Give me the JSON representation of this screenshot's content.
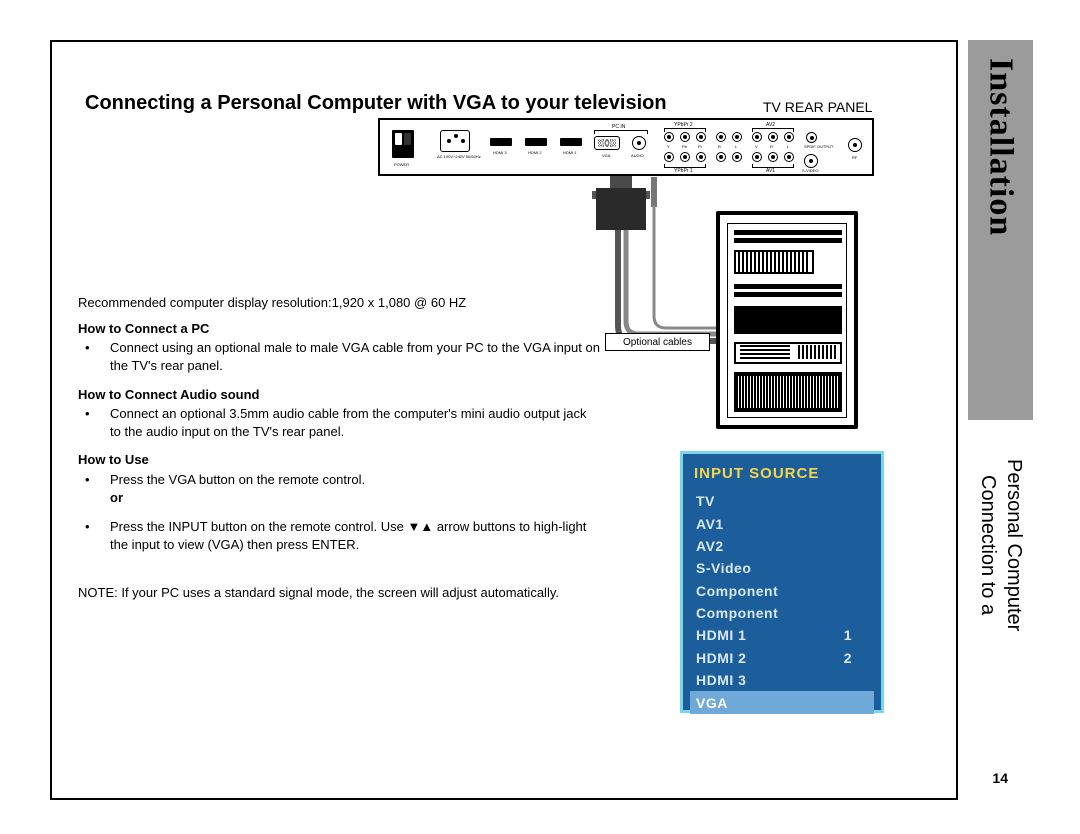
{
  "sidebar": {
    "section": "Installation",
    "subtitle_line1": "Connection to a",
    "subtitle_line2": "Personal Computer"
  },
  "title": "Connecting a Personal Computer with VGA to your television",
  "rear_panel_label": "TV REAR PANEL",
  "rear_panel_ports": {
    "power": "POWER",
    "ac": "AC 100V~240V\n50/60Hz",
    "hdmi3": "HDMI 3",
    "hdmi2": "HDMI 2",
    "hdmi1": "HDMI 1",
    "pcin": "PC IN",
    "vga": "VGA",
    "audio": "AUDIO",
    "ypbpr2": "YPbPr 2",
    "ypbpr1": "YPbPr 1",
    "y": "Y",
    "pb": "Pb",
    "pr": "Pr",
    "r": "R",
    "l": "L",
    "av2": "AV2",
    "av1": "AV1",
    "v": "V",
    "spdif": "SPDIF\nOUTPUT",
    "svideo": "S-VIDEO",
    "rf": "RF"
  },
  "optional_cables": "Optional cables",
  "body": {
    "resolution": "Recommended computer display resolution:1,920 x 1,080 @ 60 HZ",
    "h1": "How to Connect a PC",
    "b1": "Connect using an optional male to male VGA cable from your PC to the VGA input on the TV's rear panel.",
    "h2": "How to Connect Audio sound",
    "b2": "Connect an optional 3.5mm audio cable from the computer's mini audio output jack to the audio input on the TV's rear panel.",
    "h3": "How to Use",
    "b3": "Press the VGA button on the remote control.",
    "or": "or",
    "b4a": "Press the INPUT button on the remote control. Use ",
    "b4arrows": "▼▲",
    "b4b": " arrow buttons to high-light the input to view (VGA) then press ENTER.",
    "note": "NOTE: If your PC uses a standard signal mode, the screen will adjust automatically."
  },
  "osd": {
    "title": "INPUT SOURCE",
    "items": [
      {
        "label": "TV",
        "num": ""
      },
      {
        "label": "AV1",
        "num": ""
      },
      {
        "label": "AV2",
        "num": ""
      },
      {
        "label": "S-Video",
        "num": ""
      },
      {
        "label": "Component",
        "num": ""
      },
      {
        "label": "Component",
        "num": ""
      },
      {
        "label": "HDMI 1",
        "num": "1"
      },
      {
        "label": "HDMI 2",
        "num": "2"
      },
      {
        "label": "HDMI 3",
        "num": ""
      },
      {
        "label": "VGA",
        "num": ""
      }
    ],
    "selected_index": 9
  },
  "page_number": "14"
}
